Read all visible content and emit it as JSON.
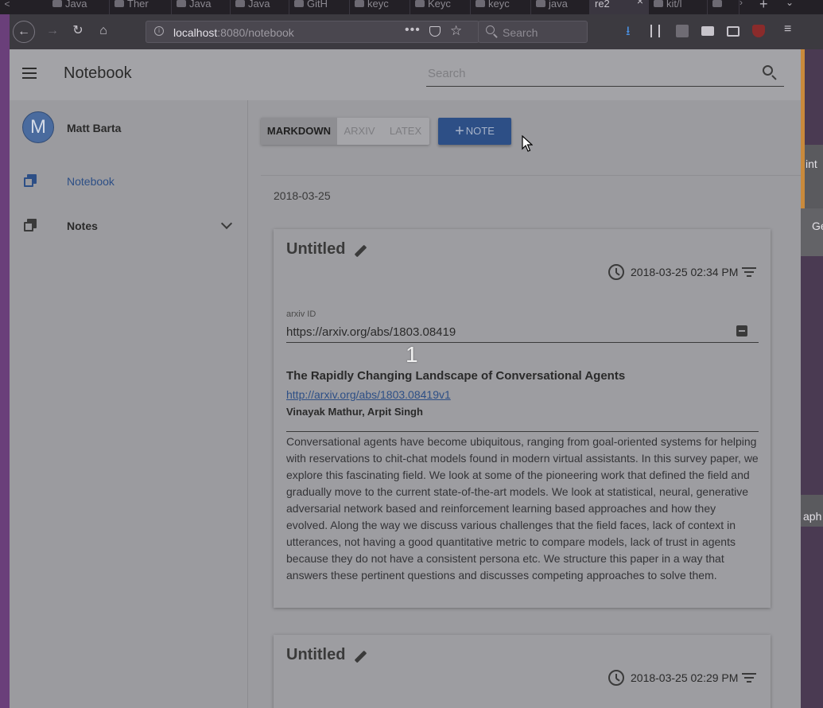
{
  "browser": {
    "tabs": [
      {
        "label": "Java",
        "active": false
      },
      {
        "label": "Ther",
        "active": false
      },
      {
        "label": "Java",
        "active": false
      },
      {
        "label": "Java",
        "active": false
      },
      {
        "label": "GitH",
        "active": false
      },
      {
        "label": "keyc",
        "active": false
      },
      {
        "label": "Keyc",
        "active": false
      },
      {
        "label": "keyc",
        "active": false
      },
      {
        "label": "java",
        "active": false
      },
      {
        "label": "re2",
        "active": true
      },
      {
        "label": "kit/l",
        "active": false
      }
    ],
    "new_tab": "+",
    "url": {
      "host": "localhost",
      "rest": ":8080/notebook"
    },
    "url_actions": "•••",
    "search_placeholder": "Search",
    "icons": [
      "back-arrow",
      "forward-arrow",
      "reload",
      "home",
      "info",
      "pocket",
      "star",
      "download",
      "library",
      "extension",
      "sidebar",
      "ublock",
      "hamburger-menu"
    ]
  },
  "desktop": {
    "strip_texts": [
      "int",
      "Ge",
      "aph"
    ]
  },
  "app": {
    "title": "Notebook",
    "search_placeholder": "Search",
    "user": {
      "initial": "M",
      "name": "Matt Barta"
    },
    "drawer": {
      "items": [
        {
          "label": "Notebook",
          "active": true
        },
        {
          "label": "Notes",
          "active": false,
          "expandable": true
        }
      ]
    },
    "mode_tabs": [
      {
        "label": "MARKDOWN",
        "active": true
      },
      {
        "label": "ARXIV",
        "active": false
      },
      {
        "label": "LATEX",
        "active": false
      }
    ],
    "add_note_label": "NOTE",
    "date_heading": "2018-03-25",
    "notes": [
      {
        "title": "Untitled",
        "timestamp": "2018-03-25 02:34 PM",
        "arxiv_label": "arxiv ID",
        "arxiv_value": "https://arxiv.org/abs/1803.08419",
        "paper": {
          "title": "The Rapidly Changing Landscape of Conversational Agents",
          "link": "http://arxiv.org/abs/1803.08419v1",
          "authors": "Vinayak Mathur, Arpit Singh",
          "abstract": "Conversational agents have become ubiquitous, ranging from goal-oriented systems for helping with reservations to chit-chat models found in modern virtual assistants. In this survey paper, we explore this fascinating field. We look at some of the pioneering work that defined the field and gradually move to the current state-of-the-art models. We look at statistical, neural, generative adversarial network based and reinforcement learning based approaches and how they evolved. Along the way we discuss various challenges that the field faces, lack of context in utterances, not having a good quantitative metric to compare models, lack of trust in agents because they do not have a consistent persona etc. We structure this paper in a way that answers these pertinent questions and discusses competing approaches to solve them."
        }
      },
      {
        "title": "Untitled",
        "timestamp": "2018-03-25 02:29 PM"
      }
    ]
  },
  "overlay": {
    "step_number": "1"
  },
  "colors": {
    "primary": "#2d4f86",
    "overlay_dim": "#9b9b9f"
  }
}
